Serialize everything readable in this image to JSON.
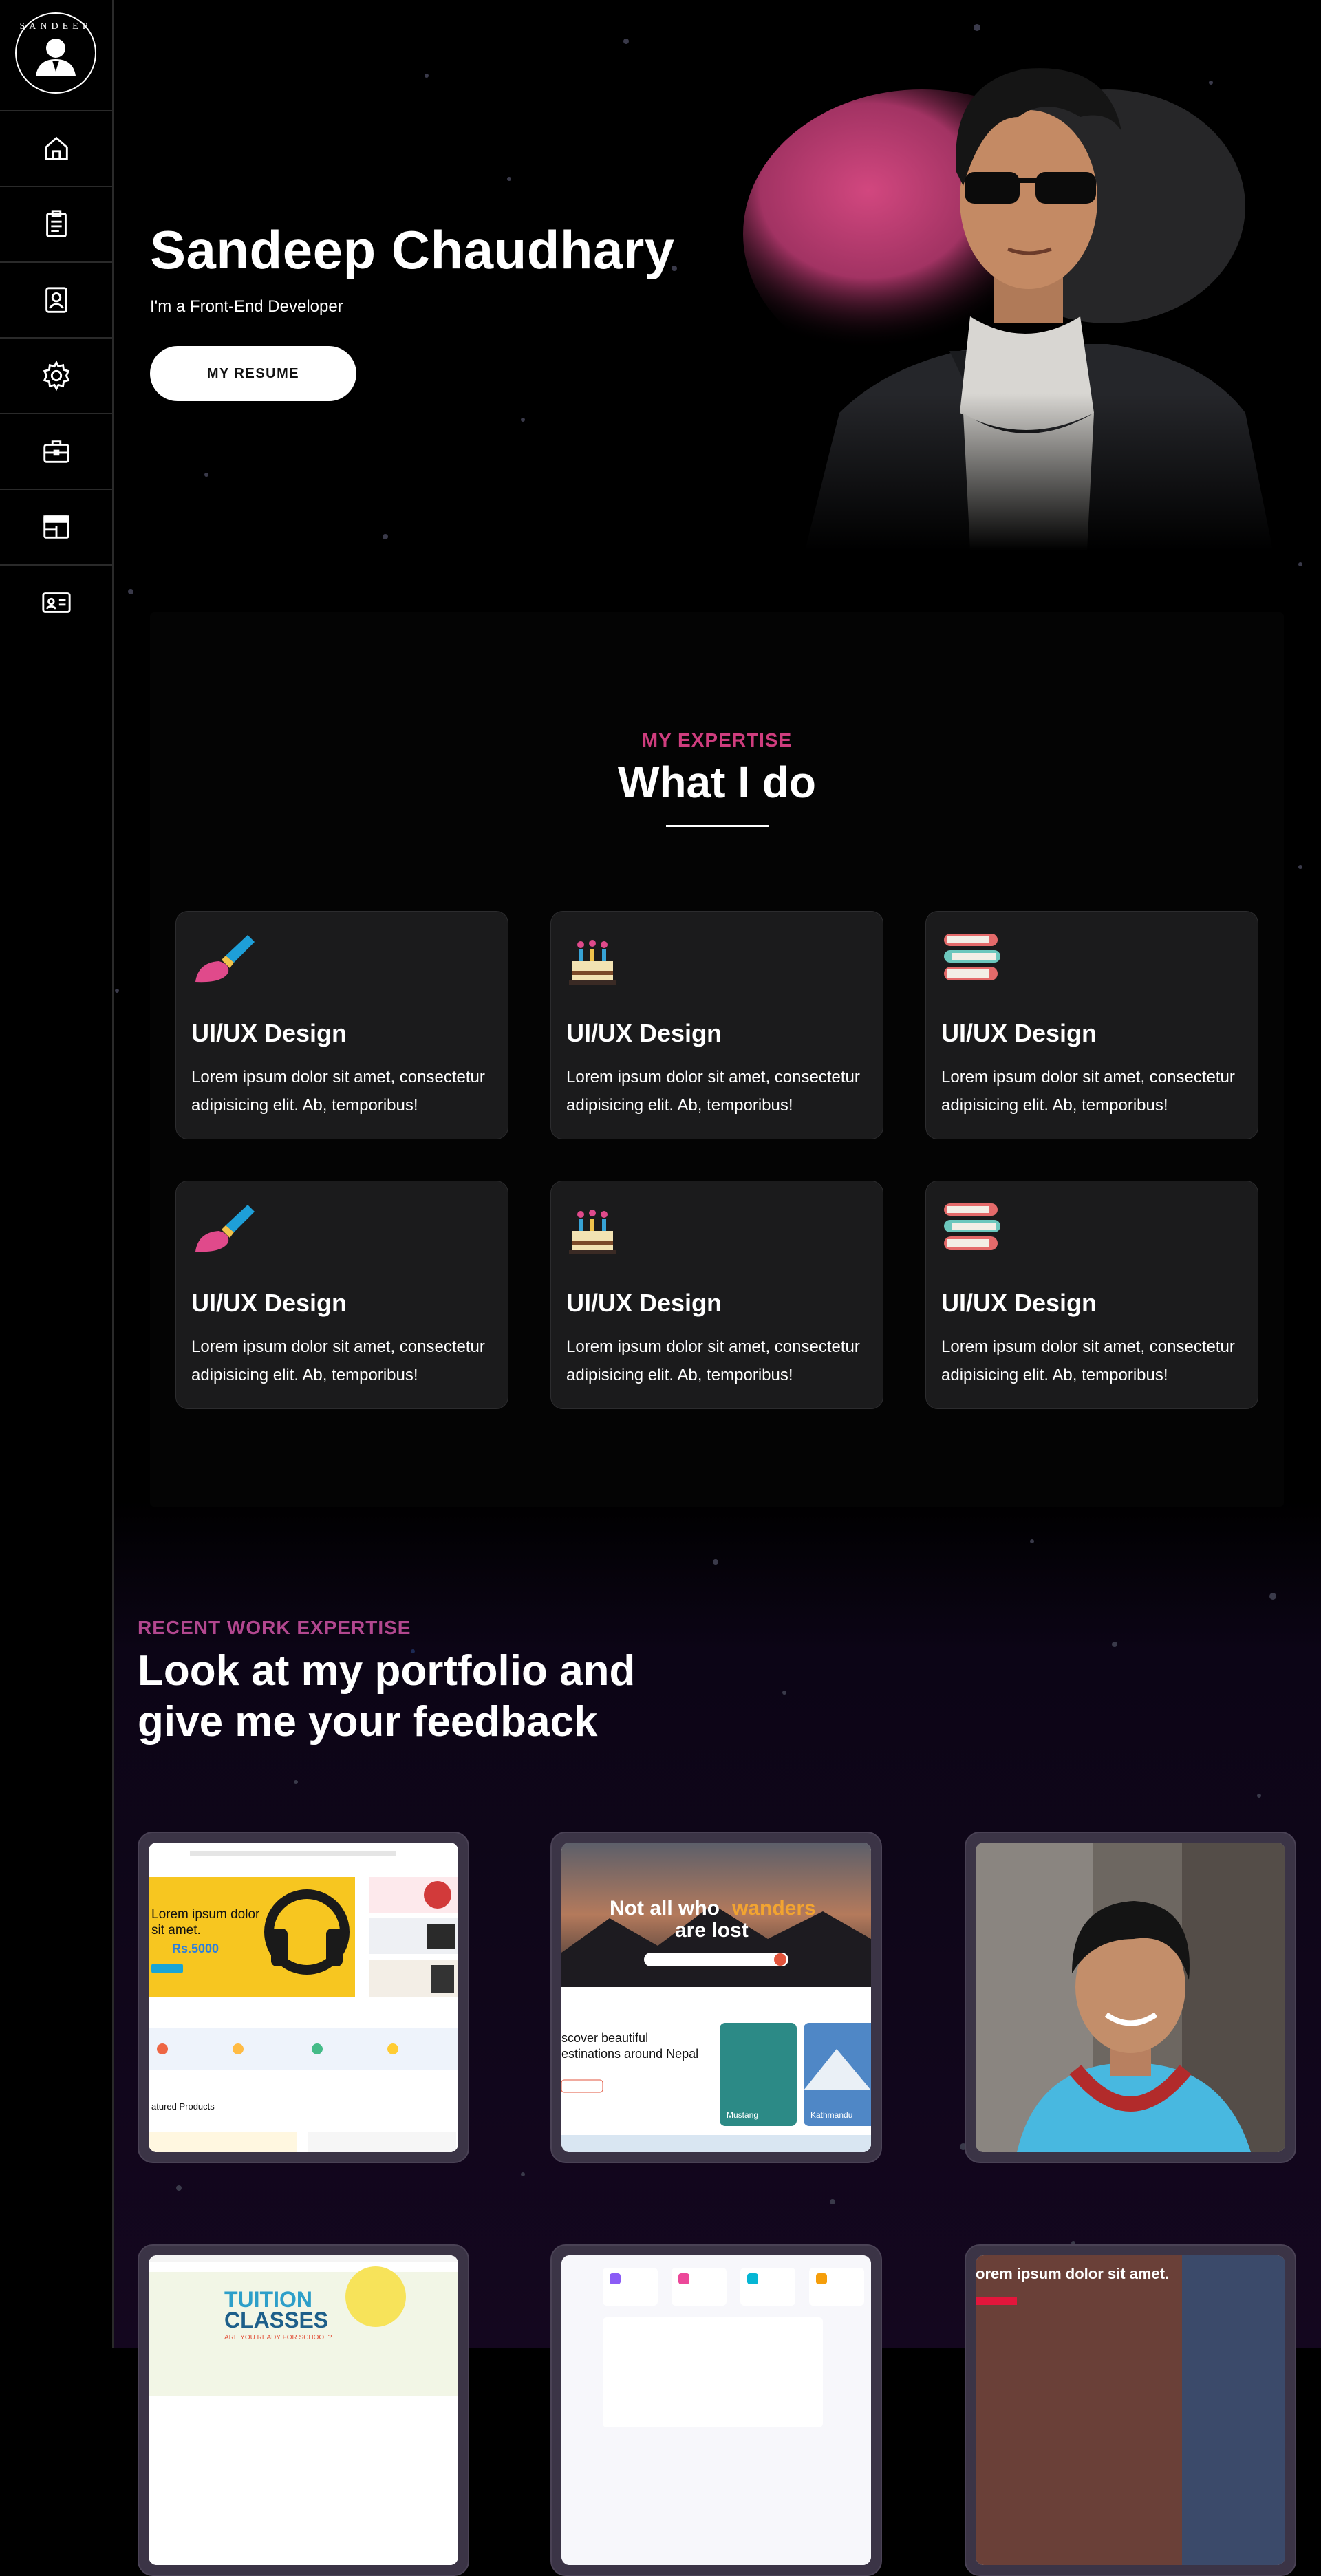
{
  "sidebar": {
    "logo_text": "SANDEEP",
    "items": [
      {
        "icon": "home-icon"
      },
      {
        "icon": "clipboard-icon"
      },
      {
        "icon": "contact-icon"
      },
      {
        "icon": "gear-icon"
      },
      {
        "icon": "briefcase-icon"
      },
      {
        "icon": "layout-icon"
      },
      {
        "icon": "id-card-icon"
      }
    ]
  },
  "hero": {
    "name": "Sandeep Chaudhary",
    "role": "I'm a Front-End Developer",
    "button_label": "MY RESUME"
  },
  "expertise": {
    "kicker": "MY EXPERTISE",
    "title": "What I do",
    "cards": [
      {
        "icon": "paintbrush-icon",
        "title": "UI/UX Design",
        "text": "Lorem ipsum dolor sit amet, consectetur adipisicing elit. Ab, temporibus!"
      },
      {
        "icon": "cake-icon",
        "title": "UI/UX Design",
        "text": "Lorem ipsum dolor sit amet, consectetur adipisicing elit. Ab, temporibus!"
      },
      {
        "icon": "books-icon",
        "title": "UI/UX Design",
        "text": "Lorem ipsum dolor sit amet, consectetur adipisicing elit. Ab, temporibus!"
      },
      {
        "icon": "paintbrush-icon",
        "title": "UI/UX Design",
        "text": "Lorem ipsum dolor sit amet, consectetur adipisicing elit. Ab, temporibus!"
      },
      {
        "icon": "cake-icon",
        "title": "UI/UX Design",
        "text": "Lorem ipsum dolor sit amet, consectetur adipisicing elit. Ab, temporibus!"
      },
      {
        "icon": "books-icon",
        "title": "UI/UX Design",
        "text": "Lorem ipsum dolor sit amet, consectetur adipisicing elit. Ab, temporibus!"
      }
    ]
  },
  "portfolio": {
    "kicker": "RECENT WORK EXPERTISE",
    "title": "Look at my portfolio and give me your feedback",
    "shop": {
      "hero_text_1": "Lorem ipsum dolor",
      "hero_text_2": "sit amet.",
      "price": "Rs.5000",
      "section_label": "atured Products"
    },
    "travel": {
      "headline_1": "Not all who",
      "headline_accent": "wanders",
      "headline_2": "are lost",
      "sub_1": "scover beautiful",
      "sub_2": "estinations around Nepal",
      "card_1": "Mustang",
      "card_2": "Kathmandu"
    },
    "tuition": {
      "title": "TUITION",
      "title_2": "CLASSES",
      "tag": "ARE YOU READY FOR SCHOOL?"
    },
    "blog": {
      "headline": "orem ipsum dolor sit amet."
    }
  },
  "colors": {
    "accent_pink": "#cf3d7e",
    "accent_purple": "#b2478f",
    "card_bg": "#1b1b1c",
    "page_bg": "#000000"
  }
}
